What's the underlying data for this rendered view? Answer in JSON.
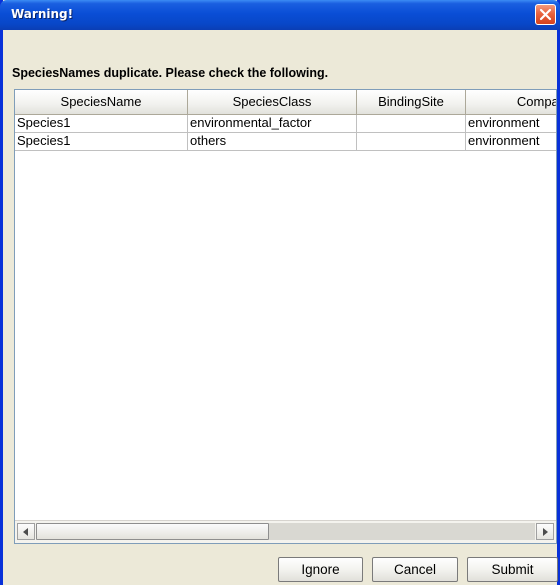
{
  "window": {
    "title": "Warning!",
    "close_icon": "close-x-icon"
  },
  "message": "SpeciesNames duplicate. Please check the following.",
  "table": {
    "columns": [
      "SpeciesName",
      "SpeciesClass",
      "BindingSite",
      "Compar"
    ],
    "rows": [
      [
        "Species1",
        "environmental_factor",
        "",
        "environment"
      ],
      [
        "Species1",
        "others",
        "",
        "environment"
      ]
    ]
  },
  "buttons": {
    "ignore": "Ignore",
    "cancel": "Cancel",
    "submit": "Submit"
  },
  "colors": {
    "titlebar": "#0a4ed6",
    "window_bg": "#ece9d8",
    "close_button": "#e8633f"
  }
}
